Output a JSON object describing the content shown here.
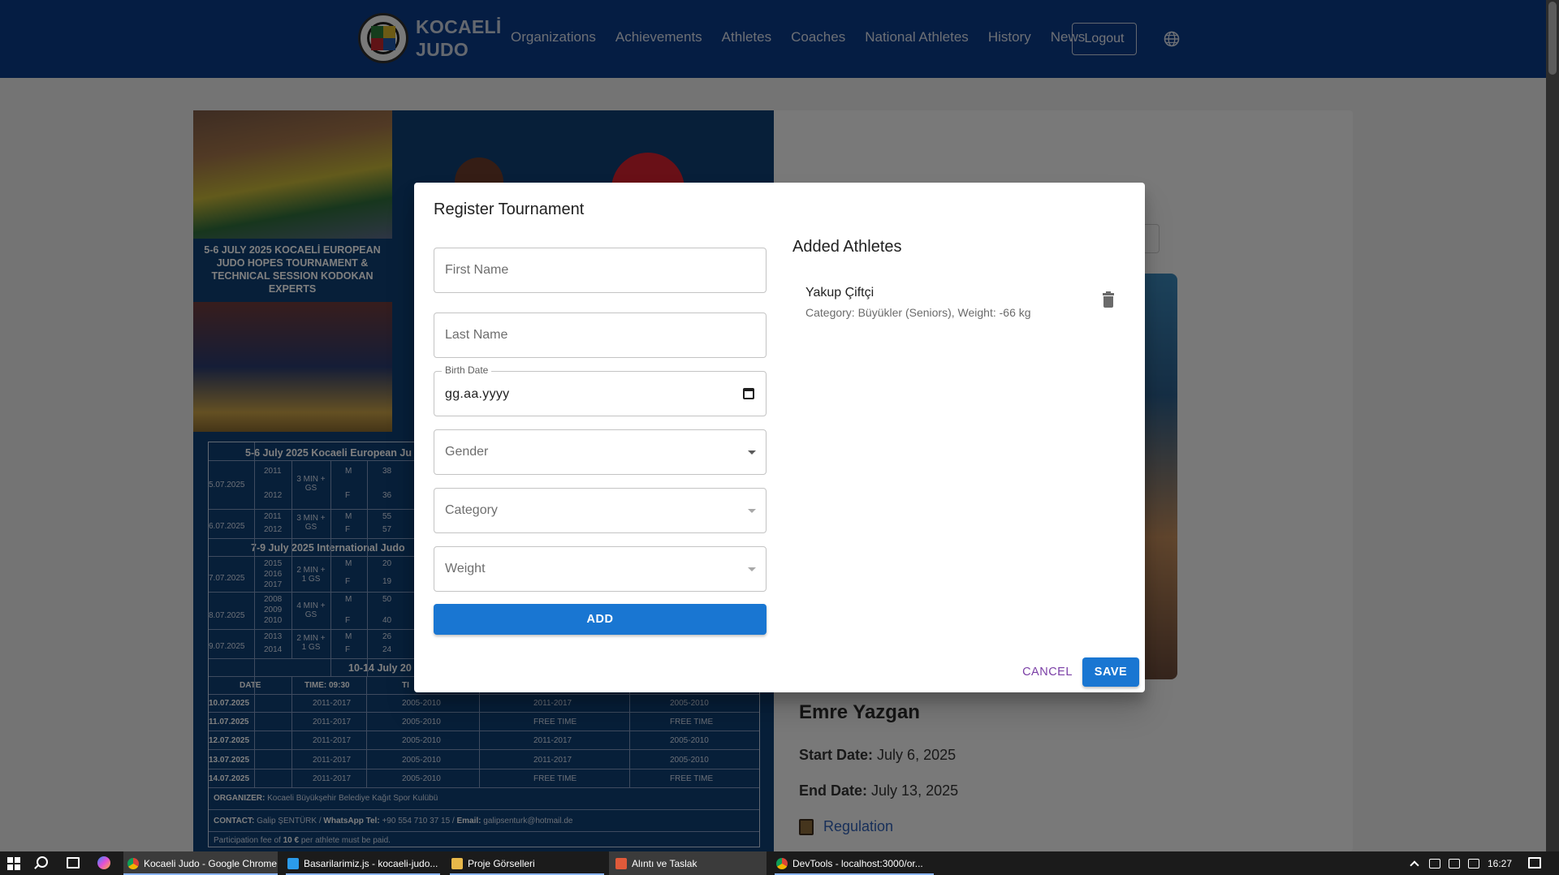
{
  "navbar": {
    "brand_line1": "KOCAELİ",
    "brand_line2": "JUDO",
    "links": [
      "Organizations",
      "Achievements",
      "Athletes",
      "Coaches",
      "National Athletes",
      "History",
      "News"
    ],
    "logout_label": "Logout",
    "globe_icon": "globe-icon",
    "bg_color": "#0b3a86"
  },
  "poster": {
    "title": "5-6 JULY 2025 KOCAELİ EUROPEAN JUDO HOPES TOURNAMENT & TECHNICAL SESSION KODOKAN EXPERTS",
    "table_header1": "5-6 July 2025 Kocaeli European Ju",
    "table_header2": "7-9 July 2025 International Judo",
    "table_header3": "10-14 July 20",
    "col_date": "DATE",
    "col_time": "TIME: 09:30",
    "col_ti": "TI",
    "rows1": [
      {
        "date": "5.07.2025",
        "years": [
          "2011",
          "2012"
        ],
        "dur": "3 MIN + GS",
        "g": [
          "M",
          "F"
        ],
        "n": [
          "38",
          "36"
        ]
      },
      {
        "date": "6.07.2025",
        "years": [
          "2011",
          "2012"
        ],
        "dur": "3 MIN + GS",
        "g": [
          "M",
          "F"
        ],
        "n": [
          "55",
          "57"
        ]
      }
    ],
    "rows2": [
      {
        "date": "7.07.2025",
        "years": [
          "2015",
          "2016",
          "2017"
        ],
        "dur": "2 MIN + 1 GS",
        "g": [
          "M",
          "F"
        ],
        "n": [
          "20",
          "19"
        ]
      },
      {
        "date": "8.07.2025",
        "years": [
          "2008",
          "2009",
          "2010"
        ],
        "dur": "4 MIN + GS",
        "g": [
          "M",
          "F"
        ],
        "n": [
          "50",
          "40"
        ]
      },
      {
        "date": "9.07.2025",
        "years": [
          "2013",
          "2014"
        ],
        "dur": "2 MIN + 1 GS",
        "g": [
          "M",
          "F"
        ],
        "n": [
          "26",
          "24"
        ]
      }
    ],
    "schedule": [
      {
        "date": "10.07.2025",
        "c1": "2011-2017",
        "c2": "2005-2010",
        "c3": "2011-2017",
        "c4": "2005-2010"
      },
      {
        "date": "11.07.2025",
        "c1": "2011-2017",
        "c2": "2005-2010",
        "c3": "FREE TIME",
        "c4": "FREE TIME"
      },
      {
        "date": "12.07.2025",
        "c1": "2011-2017",
        "c2": "2005-2010",
        "c3": "2011-2017",
        "c4": "2005-2010"
      },
      {
        "date": "13.07.2025",
        "c1": "2011-2017",
        "c2": "2005-2010",
        "c3": "2011-2017",
        "c4": "2005-2010"
      },
      {
        "date": "14.07.2025",
        "c1": "2011-2017",
        "c2": "2005-2010",
        "c3": "FREE TIME",
        "c4": "FREE TIME"
      }
    ],
    "organizer_label": "ORGANIZER:",
    "organizer": "Kocaeli Büyükşehir Belediye Kağıt Spor Kulübü",
    "contact_label": "CONTACT:",
    "contact_name": "Galip ŞENTÜRK /",
    "whatsapp_label": "WhatsApp Tel:",
    "whatsapp": "+90 554 710 37 15 /",
    "email_label": "Email:",
    "email": "galipsenturk@hotmail.de",
    "fee_prefix": "Participation fee of",
    "fee_amount": "10 €",
    "fee_suffix": "per athlete must be paid."
  },
  "page": {
    "athlete_name": "Emre Yazgan",
    "start_label": "Start Date:",
    "start_value": "July 6, 2025",
    "end_label": "End Date:",
    "end_value": "July 13, 2025",
    "regulation_link": "Regulation",
    "regulation_icon": "scroll-icon"
  },
  "dialog": {
    "title": "Register Tournament",
    "first_name_placeholder": "First Name",
    "last_name_placeholder": "Last Name",
    "birth_date_label": "Birth Date",
    "birth_date_value": "gg.aa.yyyy",
    "gender_placeholder": "Gender",
    "category_placeholder": "Category",
    "weight_placeholder": "Weight",
    "add_label": "ADD",
    "added_title": "Added Athletes",
    "athletes": [
      {
        "name": "Yakup Çiftçi",
        "detail": "Category: Büyükler (Seniors), Weight: -66 kg"
      }
    ],
    "cancel_label": "CANCEL",
    "save_label": "SAVE",
    "accent_color": "#1976d2",
    "cancel_color": "#7b3fa6"
  },
  "taskbar": {
    "apps": [
      {
        "label": "Kocaeli Judo - Google Chrome",
        "icon": "chrome-icon"
      },
      {
        "label": "Basarilarimiz.js - kocaeli-judo...",
        "icon": "vscode-icon"
      },
      {
        "label": "Proje Görselleri",
        "icon": "folder-icon"
      },
      {
        "label": "Alıntı ve Taslak",
        "icon": "snip-icon"
      },
      {
        "label": "DevTools - localhost:3000/or...",
        "icon": "chrome-icon"
      }
    ],
    "time": "16:27"
  }
}
